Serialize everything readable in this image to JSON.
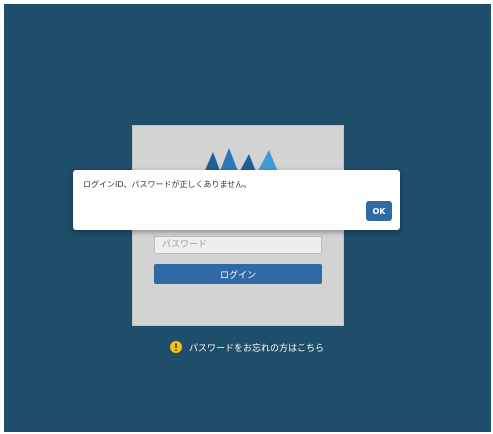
{
  "colors": {
    "background": "#1e4e6a",
    "card": "#d3d3d3",
    "accent": "#2f6aa4",
    "logo_dark": "#1f5f95",
    "logo_light": "#3f9bd6",
    "warning": "#f4c21a"
  },
  "login": {
    "logo_icon": "company-logo-icon",
    "password_placeholder": "パスワード",
    "login_label": "ログイン"
  },
  "forgot": {
    "icon": "warning-icon",
    "label": "パスワードをお忘れの方はこちら"
  },
  "alert": {
    "message": "ログインID、パスワードが正しくありません。",
    "ok_label": "OK"
  }
}
